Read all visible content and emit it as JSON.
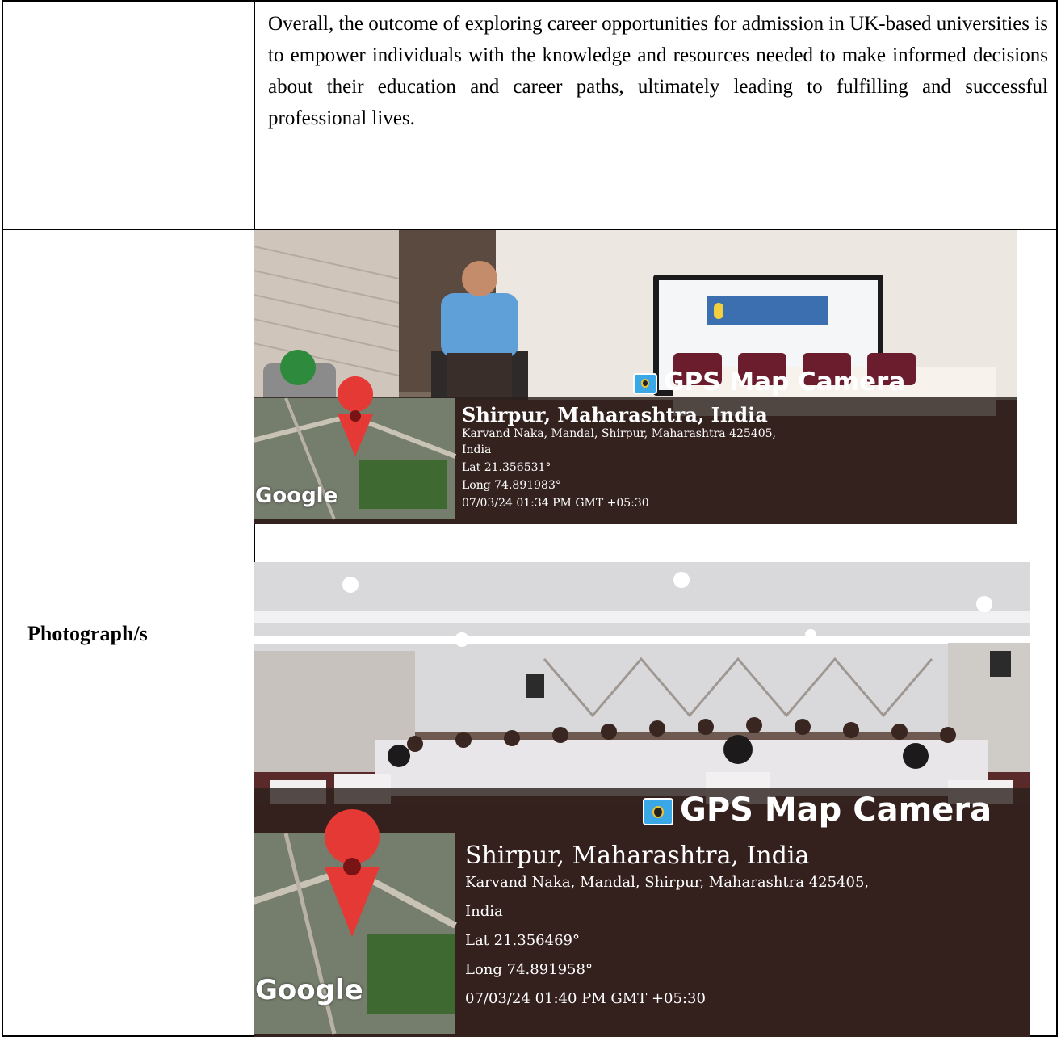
{
  "outcome_paragraph": "Overall, the outcome of exploring career opportunities for admission in UK-based universities is to empower individuals with the knowledge and resources needed to make informed decisions about their education and career paths, ultimately leading to fulfilling and successful professional lives.",
  "photographs_label": "Photograph/s",
  "photos": [
    {
      "brand": "GPS Map Camera",
      "location_title": "Shirpur, Maharashtra, India",
      "address": "Karvand Naka, Mandal, Shirpur, Maharashtra 425405,",
      "country": "India",
      "lat": "Lat 21.356531°",
      "long": "Long 74.891983°",
      "datetime": "07/03/24 01:34 PM GMT +05:30",
      "map_logo": "Google"
    },
    {
      "brand": "GPS Map Camera",
      "location_title": "Shirpur, Maharashtra, India",
      "address": "Karvand Naka, Mandal, Shirpur, Maharashtra 425405,",
      "country": "India",
      "lat": "Lat 21.356469°",
      "long": "Long 74.891958°",
      "datetime": "07/03/24 01:40 PM GMT +05:30",
      "map_logo": "Google"
    }
  ],
  "colors": {
    "map_pin": "#e53935",
    "overlay": "#2b201c",
    "accent": "#3aa7e6"
  }
}
